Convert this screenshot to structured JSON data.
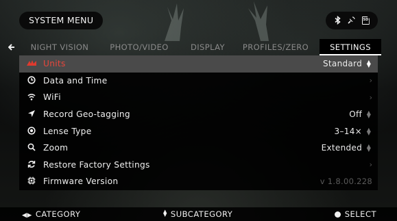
{
  "top_bar": {
    "title": "SYSTEM MENU",
    "status_icons": [
      "bluetooth-icon",
      "gps-satellite-icon",
      "sd-card-icon"
    ],
    "sd_label": "SD"
  },
  "tabs": [
    {
      "label": "NIGHT VISION",
      "active": false
    },
    {
      "label": "PHOTO/VIDEO",
      "active": false
    },
    {
      "label": "DISPLAY",
      "active": false
    },
    {
      "label": "PROFILES/ZERO",
      "active": false
    },
    {
      "label": "SETTINGS",
      "active": true
    }
  ],
  "menu": {
    "items": [
      {
        "label": "Units",
        "icon": "ruler-icon",
        "value": "Standard",
        "control": "select",
        "selected": true
      },
      {
        "label": "Data and Time",
        "icon": "clock-icon",
        "value": "",
        "control": "chevron"
      },
      {
        "label": "WiFi",
        "icon": "wifi-icon",
        "value": "",
        "control": "chevron"
      },
      {
        "label": "Record Geo-tagging",
        "icon": "location-arrow-icon",
        "value": "Off",
        "control": "select"
      },
      {
        "label": "Lense Type",
        "icon": "target-circle-icon",
        "value": "3–14×",
        "control": "select"
      },
      {
        "label": "Zoom",
        "icon": "magnifier-icon",
        "value": "Extended",
        "control": "select"
      },
      {
        "label": "Restore Factory Settings",
        "icon": "refresh-icon",
        "value": "",
        "control": "chevron"
      },
      {
        "label": "Firmware Version",
        "icon": "chip-icon",
        "value": "v 1.8.00.228",
        "control": "readonly"
      }
    ]
  },
  "bottom_bar": {
    "category": "CATEGORY",
    "subcategory": "SUBCATEGORY",
    "select": "SELECT"
  },
  "colors": {
    "accent_red": "#e8463b",
    "selected_row": "#4a4a4a",
    "row_bg": "#000000",
    "text": "#f0f0f0"
  }
}
